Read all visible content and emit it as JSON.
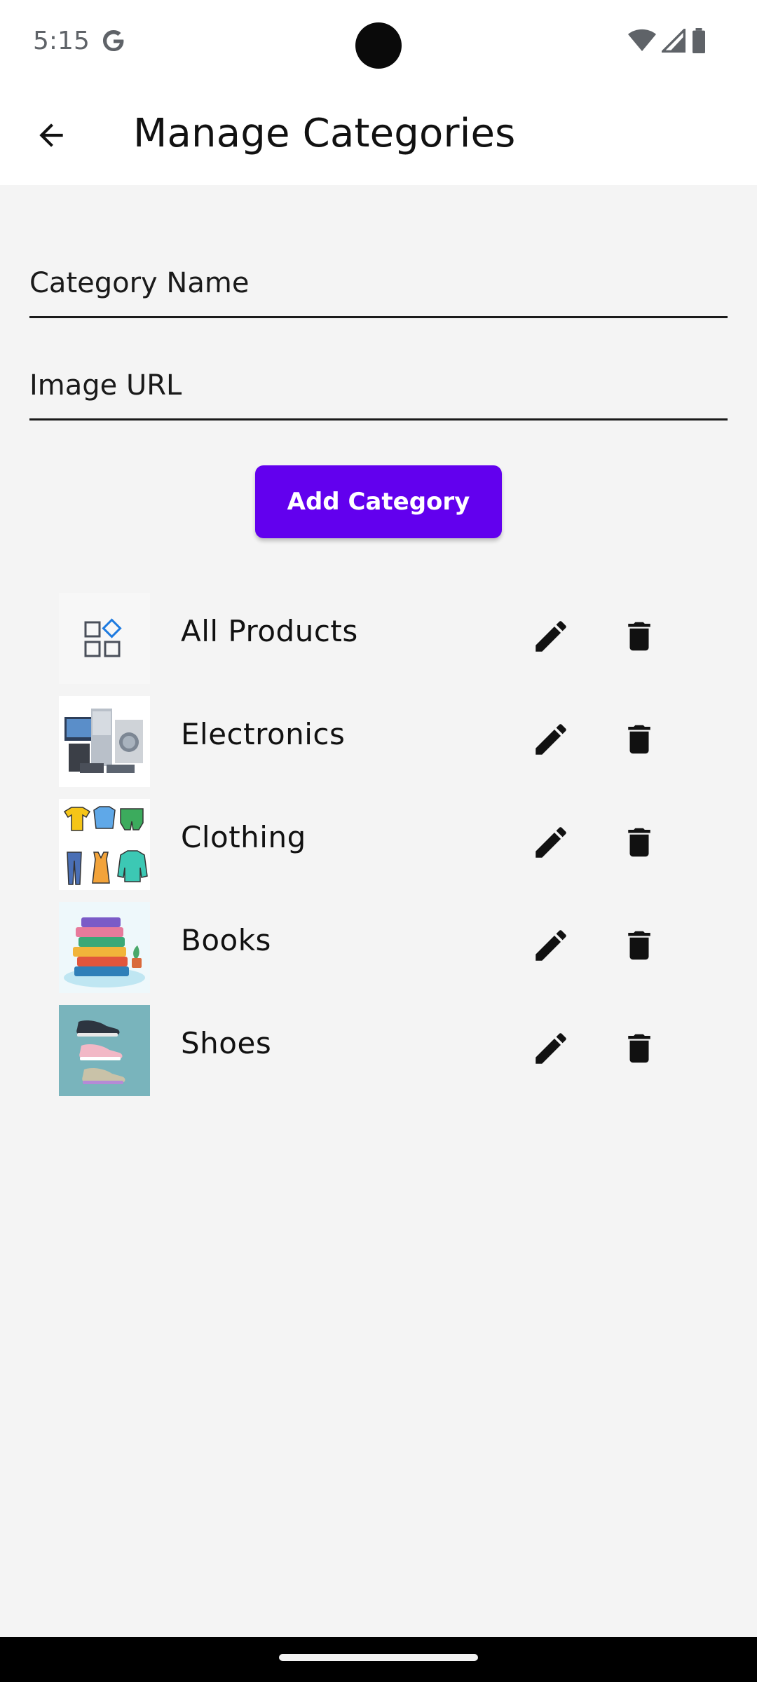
{
  "status_bar": {
    "time": "5:15",
    "icons": [
      "google-icon",
      "wifi-icon",
      "signal-icon",
      "battery-icon"
    ]
  },
  "app_bar": {
    "title": "Manage Categories",
    "back_icon": "arrow-back-icon"
  },
  "form": {
    "name_placeholder": "Category Name",
    "name_value": "",
    "url_placeholder": "Image URL",
    "url_value": "",
    "add_button_label": "Add Category"
  },
  "categories": [
    {
      "label": "All Products",
      "thumbnail": "grid-icon"
    },
    {
      "label": "Electronics",
      "thumbnail": "electronics-image"
    },
    {
      "label": "Clothing",
      "thumbnail": "clothing-image"
    },
    {
      "label": "Books",
      "thumbnail": "books-image"
    },
    {
      "label": "Shoes",
      "thumbnail": "shoes-image"
    }
  ],
  "row_actions": {
    "edit_icon": "edit-icon",
    "delete_icon": "delete-icon"
  },
  "colors": {
    "accent": "#6200ee",
    "background": "#f4f4f4",
    "surface": "#ffffff",
    "text": "#111111"
  }
}
